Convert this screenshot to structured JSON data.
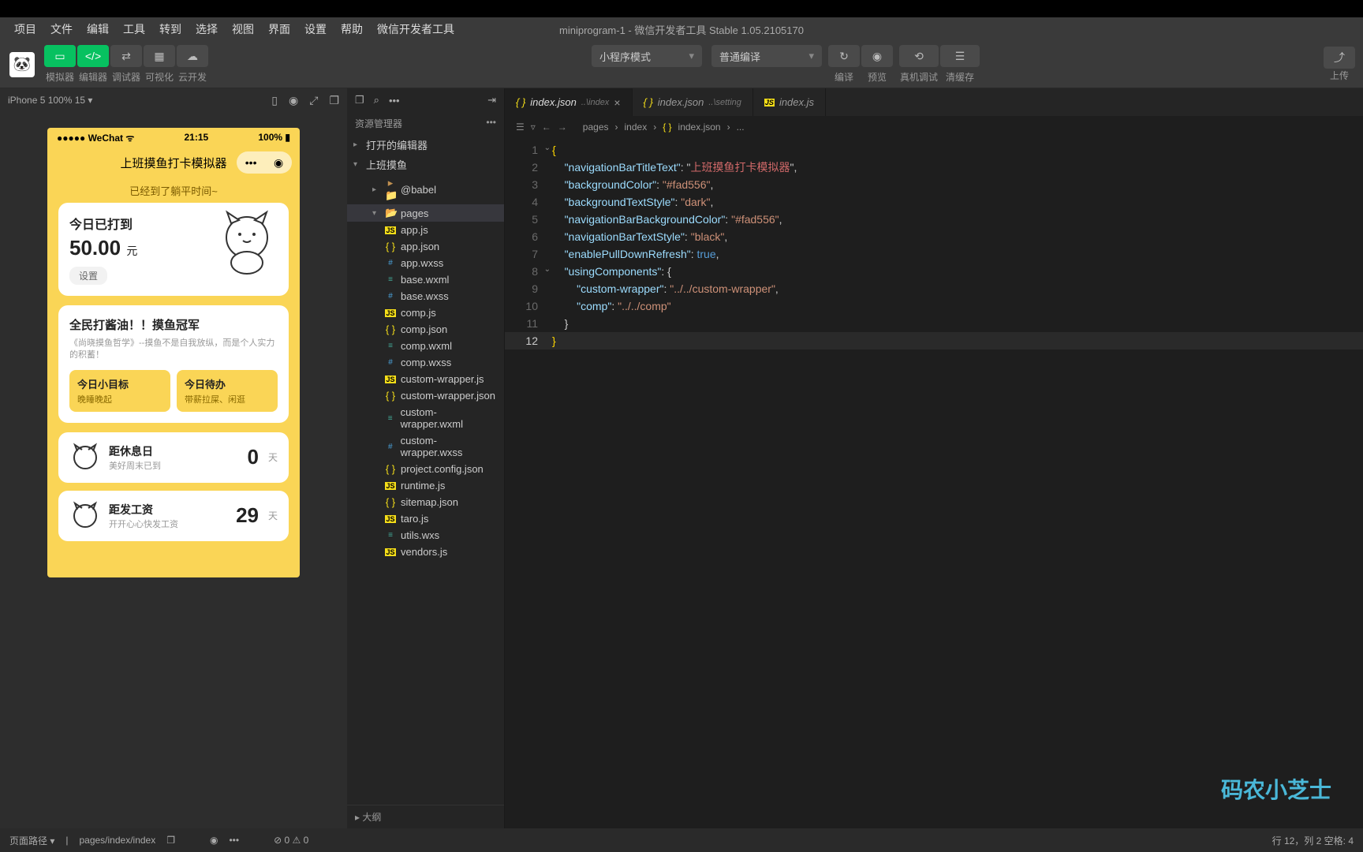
{
  "window_title": "miniprogram-1 - 微信开发者工具 Stable 1.05.2105170",
  "menu": [
    "项目",
    "文件",
    "编辑",
    "工具",
    "转到",
    "选择",
    "视图",
    "界面",
    "设置",
    "帮助",
    "微信开发者工具"
  ],
  "toolbar": {
    "views": [
      {
        "label": "模拟器",
        "active": true
      },
      {
        "label": "编辑器",
        "active": true
      },
      {
        "label": "调试器"
      },
      {
        "label": "可视化"
      },
      {
        "label": "云开发"
      }
    ],
    "mode_sel": "小程序模式",
    "compile_sel": "普通编译",
    "actions": [
      {
        "label": "编译"
      },
      {
        "label": "预览"
      },
      {
        "label": "真机调试"
      },
      {
        "label": "清缓存"
      }
    ],
    "upload": "上传"
  },
  "sim": {
    "device": "iPhone 5 100% 15 ▾",
    "status_left": "●●●●● WeChat",
    "status_time": "21:15",
    "status_right": "100%",
    "nav_title": "上班摸鱼打卡模拟器",
    "banner": "已经到了躺平时间~",
    "card1_title": "今日已打到",
    "card1_amount": "50.00",
    "card1_unit": "元",
    "card1_set": "设置",
    "card2_title": "全民打酱油！！摸鱼冠军",
    "card2_sub": "《尚晓摸鱼哲学》--摸鱼不是自我放纵，而是个人实力的积蓄！",
    "chip1_t": "今日小目标",
    "chip1_s": "晚睡晚起",
    "chip2_t": "今日待办",
    "chip2_s": "带薪拉屎、闲逛",
    "row1_t": "距休息日",
    "row1_s": "美好周末已到",
    "row1_n": "0",
    "row2_t": "距发工资",
    "row2_s": "开开心心快发工资",
    "row2_n": "29",
    "row_unit": "天"
  },
  "explorer": {
    "title": "资源管理器",
    "section1": "打开的编辑器",
    "section2": "上班摸鱼",
    "outline": "大纲",
    "tree": [
      {
        "ind": 2,
        "arr": "▸",
        "ico": "fold",
        "name": "@babel"
      },
      {
        "ind": 2,
        "arr": "▾",
        "ico": "fold-o",
        "name": "pages",
        "sel": true
      },
      {
        "ind": 2,
        "ico": "js",
        "name": "app.js"
      },
      {
        "ind": 2,
        "ico": "json",
        "name": "app.json"
      },
      {
        "ind": 2,
        "ico": "wxss",
        "name": "app.wxss"
      },
      {
        "ind": 2,
        "ico": "wxml",
        "name": "base.wxml"
      },
      {
        "ind": 2,
        "ico": "wxss",
        "name": "base.wxss"
      },
      {
        "ind": 2,
        "ico": "js",
        "name": "comp.js"
      },
      {
        "ind": 2,
        "ico": "json",
        "name": "comp.json"
      },
      {
        "ind": 2,
        "ico": "wxml",
        "name": "comp.wxml"
      },
      {
        "ind": 2,
        "ico": "wxss",
        "name": "comp.wxss"
      },
      {
        "ind": 2,
        "ico": "js",
        "name": "custom-wrapper.js"
      },
      {
        "ind": 2,
        "ico": "json",
        "name": "custom-wrapper.json"
      },
      {
        "ind": 2,
        "ico": "wxml",
        "name": "custom-wrapper.wxml"
      },
      {
        "ind": 2,
        "ico": "wxss",
        "name": "custom-wrapper.wxss"
      },
      {
        "ind": 2,
        "ico": "json",
        "name": "project.config.json"
      },
      {
        "ind": 2,
        "ico": "js",
        "name": "runtime.js"
      },
      {
        "ind": 2,
        "ico": "json",
        "name": "sitemap.json"
      },
      {
        "ind": 2,
        "ico": "js",
        "name": "taro.js"
      },
      {
        "ind": 2,
        "ico": "wxml",
        "name": "utils.wxs"
      },
      {
        "ind": 2,
        "ico": "js",
        "name": "vendors.js"
      }
    ]
  },
  "tabs": [
    {
      "name": "index.json",
      "path": "..\\index",
      "active": true,
      "ico": "json"
    },
    {
      "name": "index.json",
      "path": "..\\setting",
      "ico": "json"
    },
    {
      "name": "index.js",
      "ico": "js"
    }
  ],
  "breadcrumb": [
    "pages",
    "index",
    "index.json",
    "..."
  ],
  "code": {
    "navigationBarTitleText": "上班摸鱼打卡模拟器",
    "backgroundColor": "#fad556",
    "backgroundTextStyle": "dark",
    "navigationBarBackgroundColor": "#fad556",
    "navigationBarTextStyle": "black",
    "enablePullDownRefresh": "true",
    "usingComponents_key": "usingComponents",
    "custom_wrapper_k": "custom-wrapper",
    "custom_wrapper_v": "../../custom-wrapper",
    "comp_k": "comp",
    "comp_v": "../../comp"
  },
  "statusbar": {
    "left1": "页面路径 ▾",
    "left2": "pages/index/index",
    "mid": "⊘ 0 ⚠ 0",
    "right": "行 12，列 2    空格: 4"
  },
  "watermark": "码农小芝士"
}
